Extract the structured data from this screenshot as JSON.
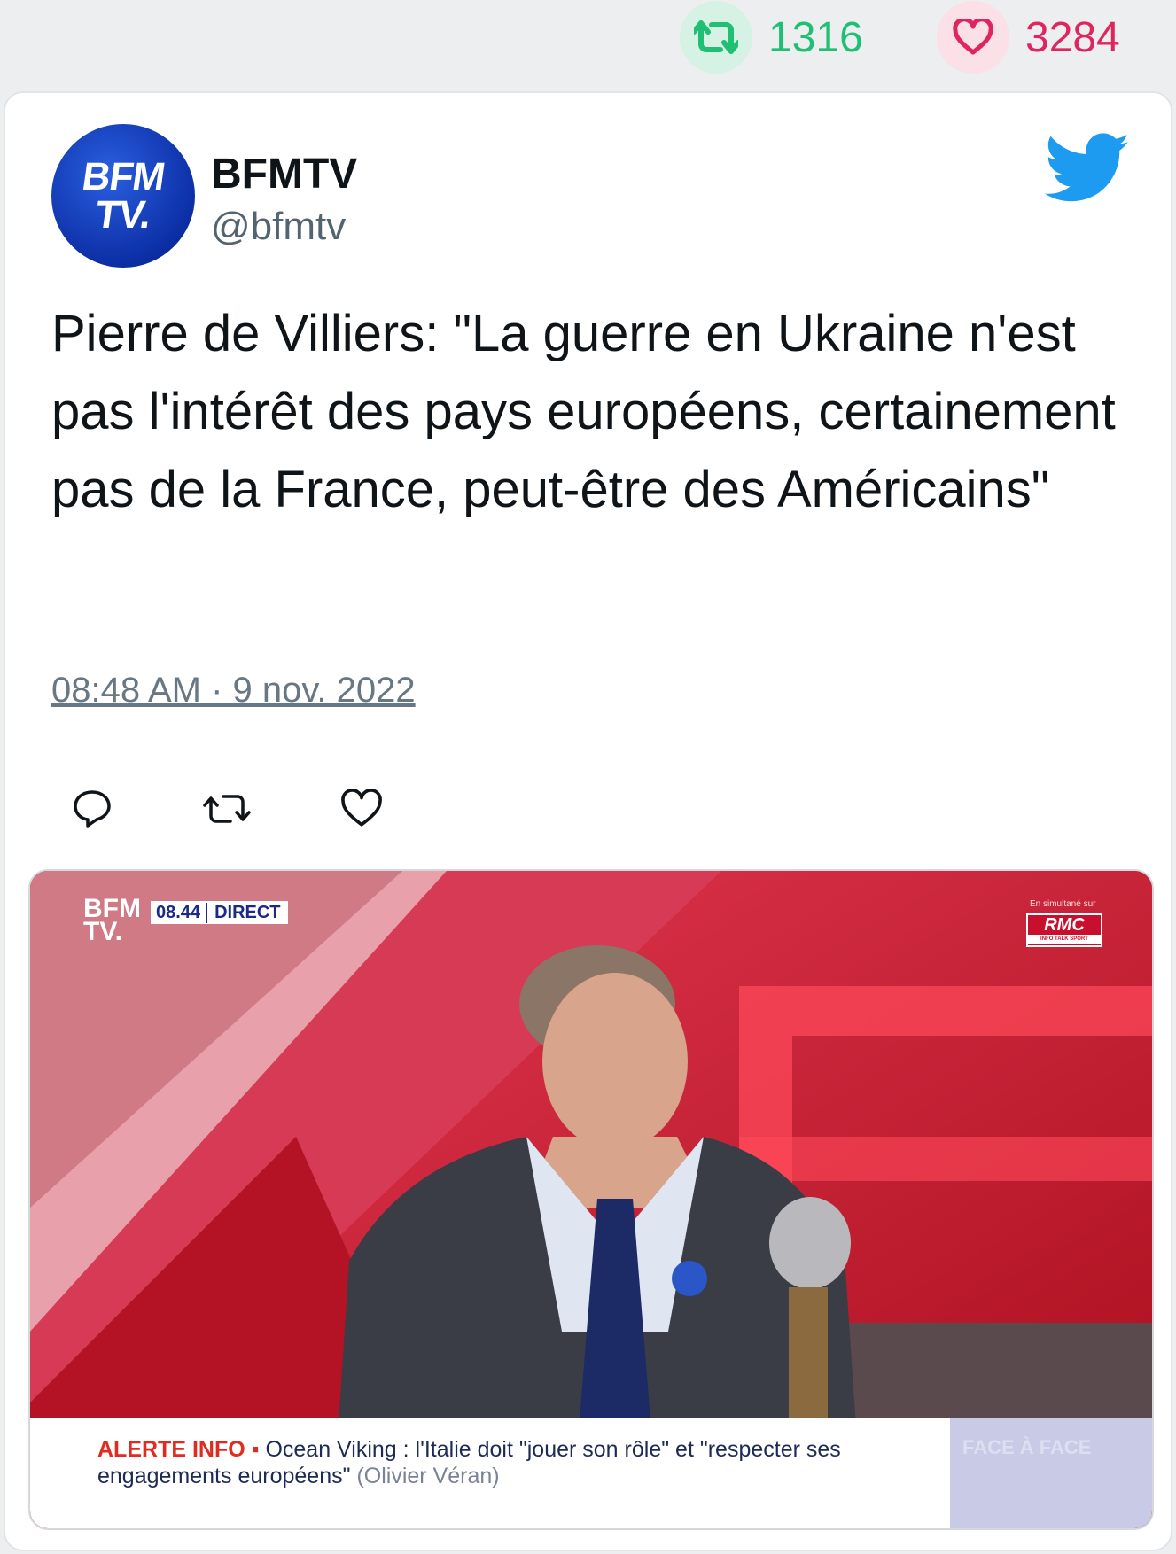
{
  "stats": {
    "retweets": "1316",
    "likes": "3284",
    "retweet_color": "#1fbf74",
    "like_color": "#e0245e"
  },
  "author": {
    "avatar_text_line1": "BFM",
    "avatar_text_line2": "TV.",
    "name": "BFMTV",
    "handle": "@bfmtv"
  },
  "tweet": {
    "text": "Pierre de Villiers: \"La guerre en Ukraine n'est pas l'intérêt des pays européens, certainement pas de la France, peut-être des Américains\"",
    "timestamp": "08:48 AM · 9 nov. 2022"
  },
  "actions": {
    "reply_icon": "reply-icon",
    "retweet_icon": "retweet-icon",
    "like_icon": "heart-icon"
  },
  "media": {
    "logo_line1": "BFM",
    "logo_line2": "TV.",
    "time": "08.44",
    "live_label": "DIRECT",
    "simulcast_label": "En simultané sur",
    "partner": "RMC",
    "partner_sub": "INFO TALK SPORT",
    "alert_label": "ALERTE INFO",
    "alert_bullet": "▪",
    "headline": "Ocean Viking : l'Italie doit \"jouer son rôle\" et \"respecter ses engagements européens\"",
    "source": "(Olivier Véran)",
    "program": "FACE À FACE"
  }
}
